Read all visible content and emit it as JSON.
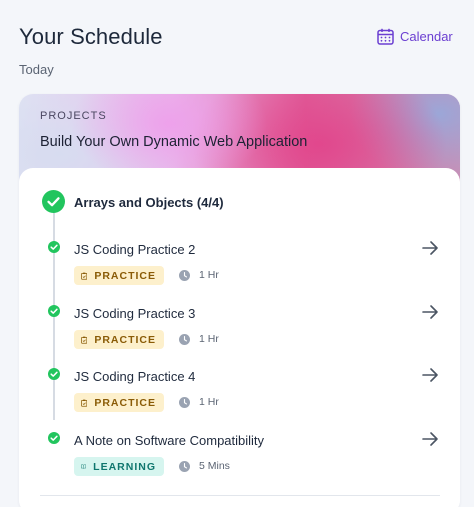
{
  "header": {
    "title": "Your Schedule",
    "subtitle": "Today",
    "calendar_label": "Calendar",
    "accent": "#6b3fd1"
  },
  "card": {
    "category": "PROJECTS",
    "title": "Build Your Own Dynamic Web Application"
  },
  "group": {
    "title": "Arrays and Objects (4/4)",
    "completed": true
  },
  "items": [
    {
      "title": "JS Coding Practice 2",
      "badge": "PRACTICE",
      "badge_icon": "clipboard-icon",
      "duration": "1 Hr",
      "completed": true
    },
    {
      "title": "JS Coding Practice 3",
      "badge": "PRACTICE",
      "badge_icon": "clipboard-icon",
      "duration": "1 Hr",
      "completed": true
    },
    {
      "title": "JS Coding Practice 4",
      "badge": "PRACTICE",
      "badge_icon": "clipboard-icon",
      "duration": "1 Hr",
      "completed": true
    },
    {
      "title": "A Note on Software Compatibility",
      "badge": "LEARNING",
      "badge_icon": "book-icon",
      "duration": "5 Mins",
      "completed": true
    }
  ],
  "colors": {
    "success": "#22c55e",
    "practice_bg": "#fdf0cc",
    "practice_text": "#8a5b06",
    "learning_bg": "#d6f5ef",
    "learning_text": "#0f766e"
  }
}
